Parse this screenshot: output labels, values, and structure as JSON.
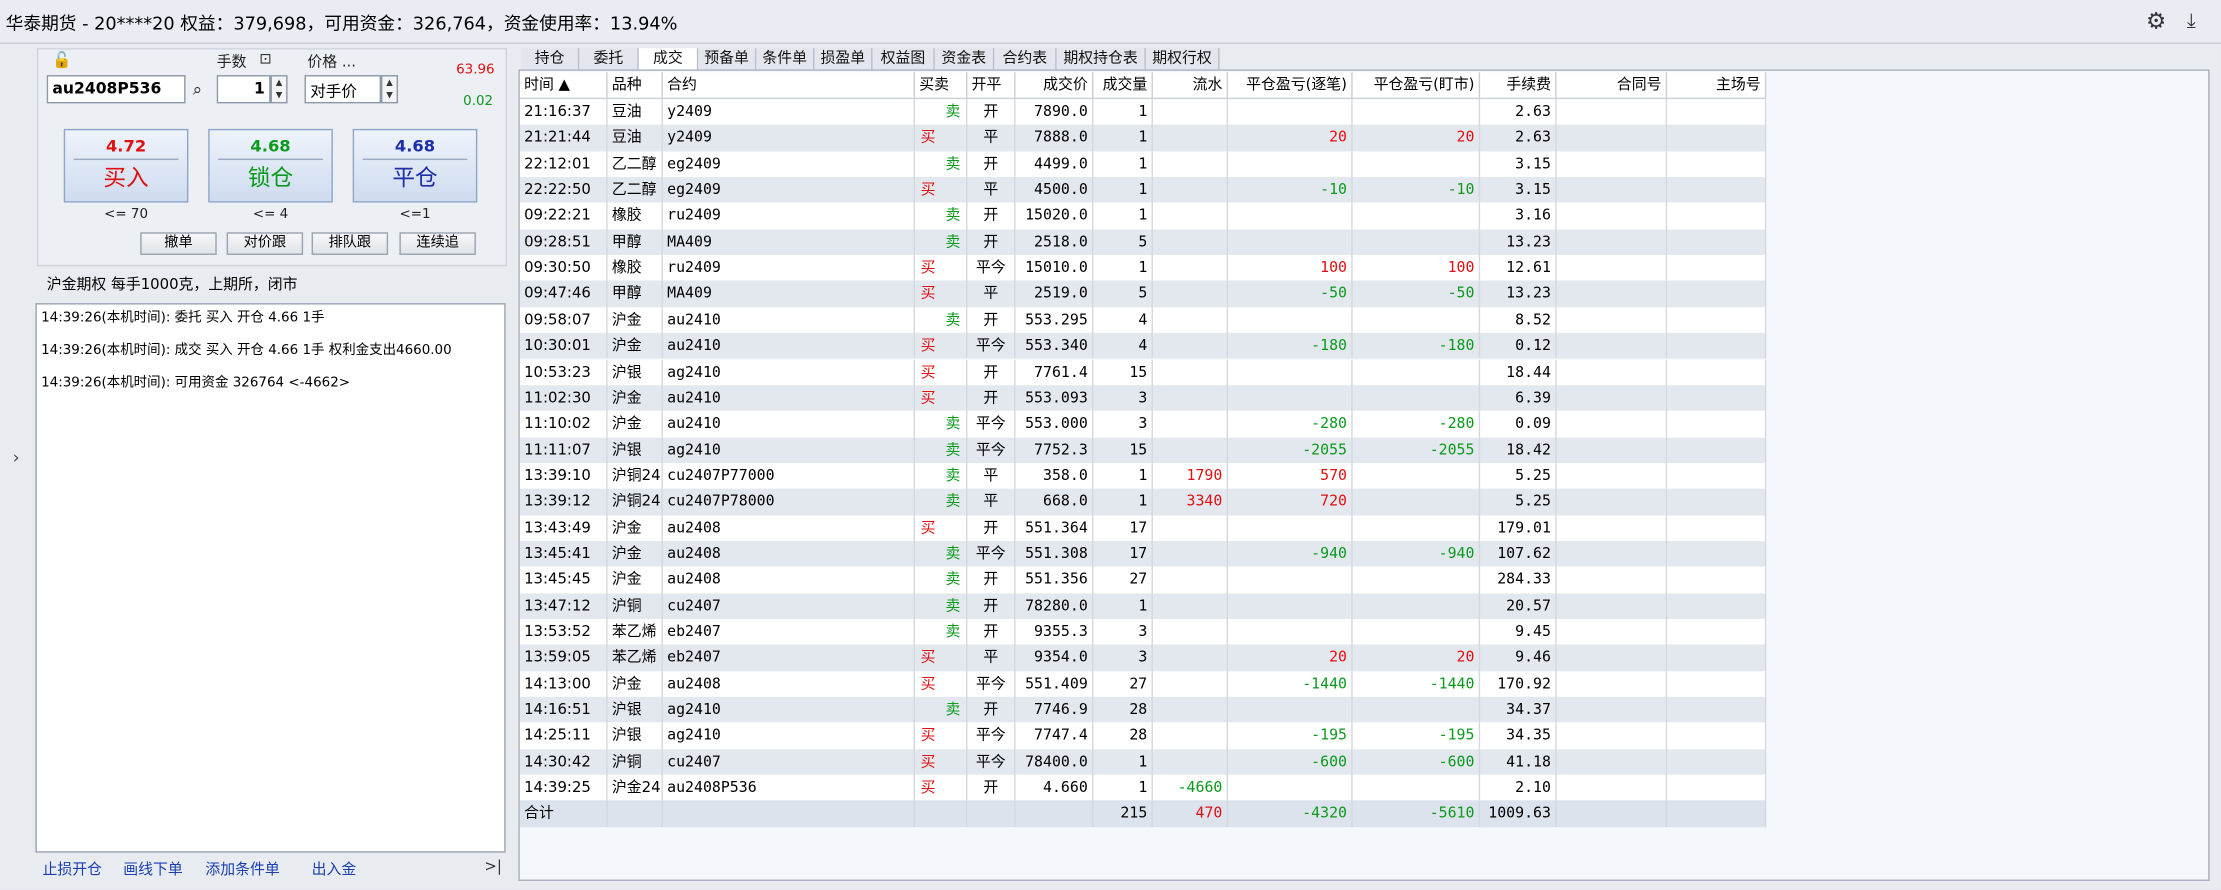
{
  "title": "华泰期货 - 20****20  权益：379,698，可用资金：326,764，资金使用率：13.94%",
  "order": {
    "lots_label": "手数",
    "price_label": "价格 ...",
    "contract_value": "au2408P536",
    "lots_value": "1",
    "price_value": "对手价",
    "upper_limit": "63.96",
    "lower_limit": "0.02",
    "buy": {
      "price": "4.72",
      "label": "买入",
      "limit": "<= 70"
    },
    "lock": {
      "price": "4.68",
      "label": "锁仓",
      "limit": "<= 4"
    },
    "close": {
      "price": "4.68",
      "label": "平仓",
      "limit": "<=1"
    },
    "small_buttons": [
      "撤单",
      "对价跟",
      "排队跟",
      "连续追"
    ]
  },
  "product_info": "沪金期权  每手1000克，上期所，闭市",
  "log": [
    "14:39:26(本机时间): 委托  买入  开仓  4.66  1手",
    "14:39:26(本机时间): 成交  买入  开仓  4.66  1手  权利金支出4660.00",
    "14:39:26(本机时间): 可用资金 326764  <-4662>"
  ],
  "bottom_links": [
    "止损开仓",
    "画线下单",
    "添加条件单",
    "出入金"
  ],
  "tabs": [
    "持仓",
    "委托",
    "成交",
    "预备单",
    "条件单",
    "损盈单",
    "权益图",
    "资金表",
    "合约表",
    "期权持仓表",
    "期权行权"
  ],
  "active_tab": "成交",
  "columns": [
    "时间 ▲",
    "品种",
    "合约",
    "买卖",
    "开平",
    "成交价",
    "成交量",
    "流水",
    "平仓盈亏(逐笔)",
    "平仓盈亏(盯市)",
    "手续费",
    "合同号",
    "主场号"
  ],
  "rows": [
    [
      "21:16:37",
      "豆油",
      "y2409",
      "卖",
      "开",
      "7890.0",
      "1",
      "",
      "",
      "",
      "2.63"
    ],
    [
      "21:21:44",
      "豆油",
      "y2409",
      "买",
      "平",
      "7888.0",
      "1",
      "",
      "20",
      "20",
      "2.63"
    ],
    [
      "22:12:01",
      "乙二醇",
      "eg2409",
      "卖",
      "开",
      "4499.0",
      "1",
      "",
      "",
      "",
      "3.15"
    ],
    [
      "22:22:50",
      "乙二醇",
      "eg2409",
      "买",
      "平",
      "4500.0",
      "1",
      "",
      "-10",
      "-10",
      "3.15"
    ],
    [
      "09:22:21",
      "橡胶",
      "ru2409",
      "卖",
      "开",
      "15020.0",
      "1",
      "",
      "",
      "",
      "3.16"
    ],
    [
      "09:28:51",
      "甲醇",
      "MA409",
      "卖",
      "开",
      "2518.0",
      "5",
      "",
      "",
      "",
      "13.23"
    ],
    [
      "09:30:50",
      "橡胶",
      "ru2409",
      "买",
      "平今",
      "15010.0",
      "1",
      "",
      "100",
      "100",
      "12.61"
    ],
    [
      "09:47:46",
      "甲醇",
      "MA409",
      "买",
      "平",
      "2519.0",
      "5",
      "",
      "-50",
      "-50",
      "13.23"
    ],
    [
      "09:58:07",
      "沪金",
      "au2410",
      "卖",
      "开",
      "553.295",
      "4",
      "",
      "",
      "",
      "8.52"
    ],
    [
      "10:30:01",
      "沪金",
      "au2410",
      "买",
      "平今",
      "553.340",
      "4",
      "",
      "-180",
      "-180",
      "0.12"
    ],
    [
      "10:53:23",
      "沪银",
      "ag2410",
      "买",
      "开",
      "7761.4",
      "15",
      "",
      "",
      "",
      "18.44"
    ],
    [
      "11:02:30",
      "沪金",
      "au2410",
      "买",
      "开",
      "553.093",
      "3",
      "",
      "",
      "",
      "6.39"
    ],
    [
      "11:10:02",
      "沪金",
      "au2410",
      "卖",
      "平今",
      "553.000",
      "3",
      "",
      "-280",
      "-280",
      "0.09"
    ],
    [
      "11:11:07",
      "沪银",
      "ag2410",
      "卖",
      "平今",
      "7752.3",
      "15",
      "",
      "-2055",
      "-2055",
      "18.42"
    ],
    [
      "13:39:10",
      "沪铜24(",
      "cu2407P77000",
      "卖",
      "平",
      "358.0",
      "1",
      "1790",
      "570",
      "",
      "5.25"
    ],
    [
      "13:39:12",
      "沪铜24(",
      "cu2407P78000",
      "卖",
      "平",
      "668.0",
      "1",
      "3340",
      "720",
      "",
      "5.25"
    ],
    [
      "13:43:49",
      "沪金",
      "au2408",
      "买",
      "开",
      "551.364",
      "17",
      "",
      "",
      "",
      "179.01"
    ],
    [
      "13:45:41",
      "沪金",
      "au2408",
      "卖",
      "平今",
      "551.308",
      "17",
      "",
      "-940",
      "-940",
      "107.62"
    ],
    [
      "13:45:45",
      "沪金",
      "au2408",
      "卖",
      "开",
      "551.356",
      "27",
      "",
      "",
      "",
      "284.33"
    ],
    [
      "13:47:12",
      "沪铜",
      "cu2407",
      "卖",
      "开",
      "78280.0",
      "1",
      "",
      "",
      "",
      "20.57"
    ],
    [
      "13:53:52",
      "苯乙烯",
      "eb2407",
      "卖",
      "开",
      "9355.3",
      "3",
      "",
      "",
      "",
      "9.45"
    ],
    [
      "13:59:05",
      "苯乙烯",
      "eb2407",
      "买",
      "平",
      "9354.0",
      "3",
      "",
      "20",
      "20",
      "9.46"
    ],
    [
      "14:13:00",
      "沪金",
      "au2408",
      "买",
      "平今",
      "551.409",
      "27",
      "",
      "-1440",
      "-1440",
      "170.92"
    ],
    [
      "14:16:51",
      "沪银",
      "ag2410",
      "卖",
      "开",
      "7746.9",
      "28",
      "",
      "",
      "",
      "34.37"
    ],
    [
      "14:25:11",
      "沪银",
      "ag2410",
      "买",
      "平今",
      "7747.4",
      "28",
      "",
      "-195",
      "-195",
      "34.35"
    ],
    [
      "14:30:42",
      "沪铜",
      "cu2407",
      "买",
      "平今",
      "78400.0",
      "1",
      "",
      "-600",
      "-600",
      "41.18"
    ],
    [
      "14:39:25",
      "沪金24(",
      "au2408P536",
      "买",
      "开",
      "4.660",
      "1",
      "-4660",
      "",
      "",
      "2.10"
    ]
  ],
  "total": {
    "label": "合计",
    "volume": "215",
    "flow": "470",
    "pnl_trade": "-4320",
    "pnl_mark": "-5610",
    "fee": "1009.63"
  },
  "colors": {
    "buy": "#e01010",
    "sell": "#0b9a1c",
    "accent": "#1a3fb0",
    "lock": "#0b9a1c",
    "close": "#1c2fa8"
  }
}
